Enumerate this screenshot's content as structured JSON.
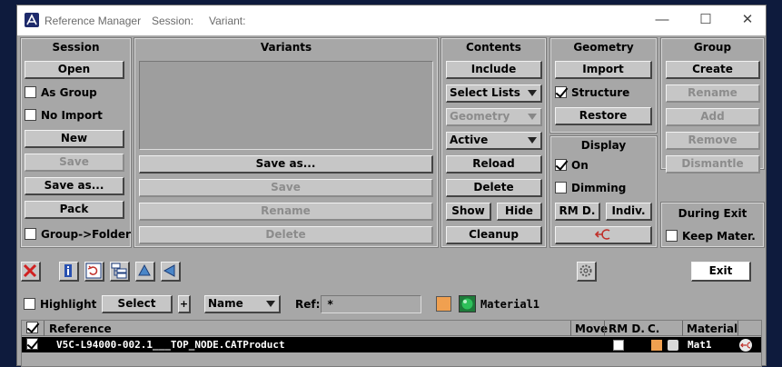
{
  "titlebar": {
    "title": "Reference Manager",
    "session_label": "Session:",
    "variant_label": "Variant:",
    "minimize_glyph": "—",
    "maximize_glyph": "☐",
    "close_glyph": "✕"
  },
  "session": {
    "title": "Session",
    "open": "Open",
    "as_group": "As Group",
    "no_import": "No Import",
    "new": "New",
    "save": "Save",
    "save_as": "Save as...",
    "pack": "Pack",
    "group_folder": "Group->Folder"
  },
  "variants": {
    "title": "Variants",
    "save_as": "Save as...",
    "save": "Save",
    "rename": "Rename",
    "delete": "Delete"
  },
  "contents": {
    "title": "Contents",
    "include": "Include",
    "select_lists": "Select Lists",
    "geometry": "Geometry",
    "active": "Active",
    "reload": "Reload",
    "delete": "Delete",
    "show": "Show",
    "hide": "Hide",
    "cleanup": "Cleanup"
  },
  "geometry": {
    "title": "Geometry",
    "import": "Import",
    "structure": "Structure",
    "restore": "Restore"
  },
  "display": {
    "title": "Display",
    "on": "On",
    "dimming": "Dimming",
    "rm_d": "RM D.",
    "indiv": "Indiv."
  },
  "group": {
    "title": "Group",
    "create": "Create",
    "rename": "Rename",
    "add": "Add",
    "remove": "Remove",
    "dismantle": "Dismantle"
  },
  "during_exit": {
    "title": "During Exit",
    "keep_mater": "Keep Mater."
  },
  "toolbar": {
    "exit": "Exit"
  },
  "filter": {
    "highlight": "Highlight",
    "select": "Select",
    "plus": "+",
    "name_option": "Name",
    "ref_label": "Ref:",
    "ref_value": "*",
    "material_label": "Material1"
  },
  "table": {
    "columns": [
      "Reference",
      "Move",
      "RM D.",
      "C.",
      "Material"
    ],
    "rows": [
      {
        "reference": "V5C-L94000-002.1___TOP_NODE.CATProduct",
        "material": "Mat1"
      }
    ]
  },
  "colors": {
    "window_bg": "#a7a7a7",
    "material_orange": "#f0a050",
    "material_green": "#2aa84a",
    "row_bg": "#000000"
  }
}
